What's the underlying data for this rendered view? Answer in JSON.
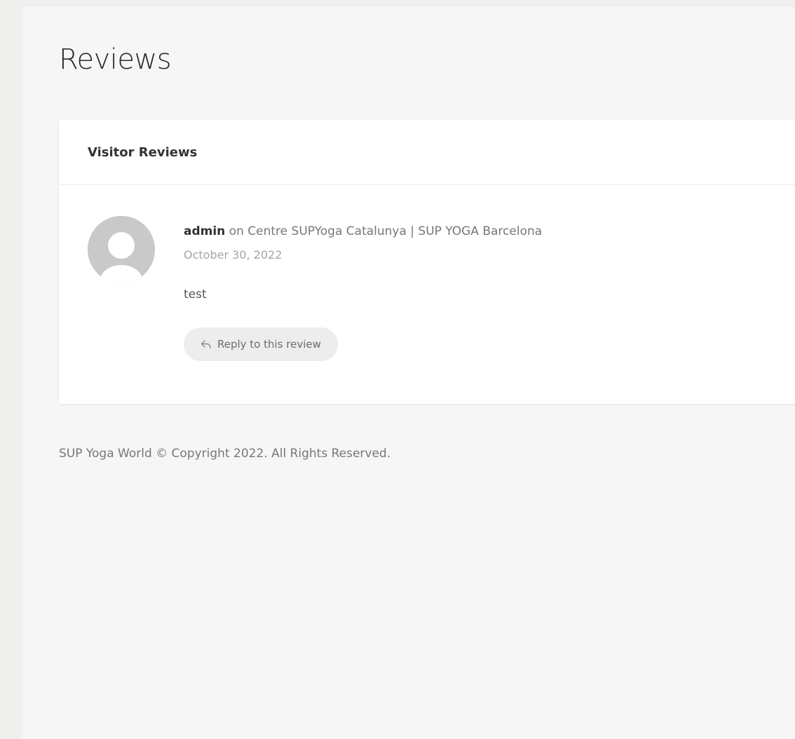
{
  "page": {
    "title": "Reviews"
  },
  "card": {
    "title": "Visitor Reviews"
  },
  "review": {
    "author": "admin",
    "on_text": " on ",
    "place": "Centre SUPYoga Catalunya | SUP YOGA Barcelona",
    "date": "October 30, 2022",
    "text": "test",
    "reply_label": "Reply to this review",
    "avatar_icon": "default-avatar-icon",
    "reply_icon": "reply-arrow-icon"
  },
  "footer": {
    "copyright": "SUP Yoga World © Copyright 2022. All Rights Reserved."
  },
  "colors": {
    "page_bg": "#efefed",
    "content_bg": "#f6f6f6",
    "card_bg": "#ffffff",
    "avatar_bg": "#c9c9c9",
    "button_bg": "#ededed"
  }
}
